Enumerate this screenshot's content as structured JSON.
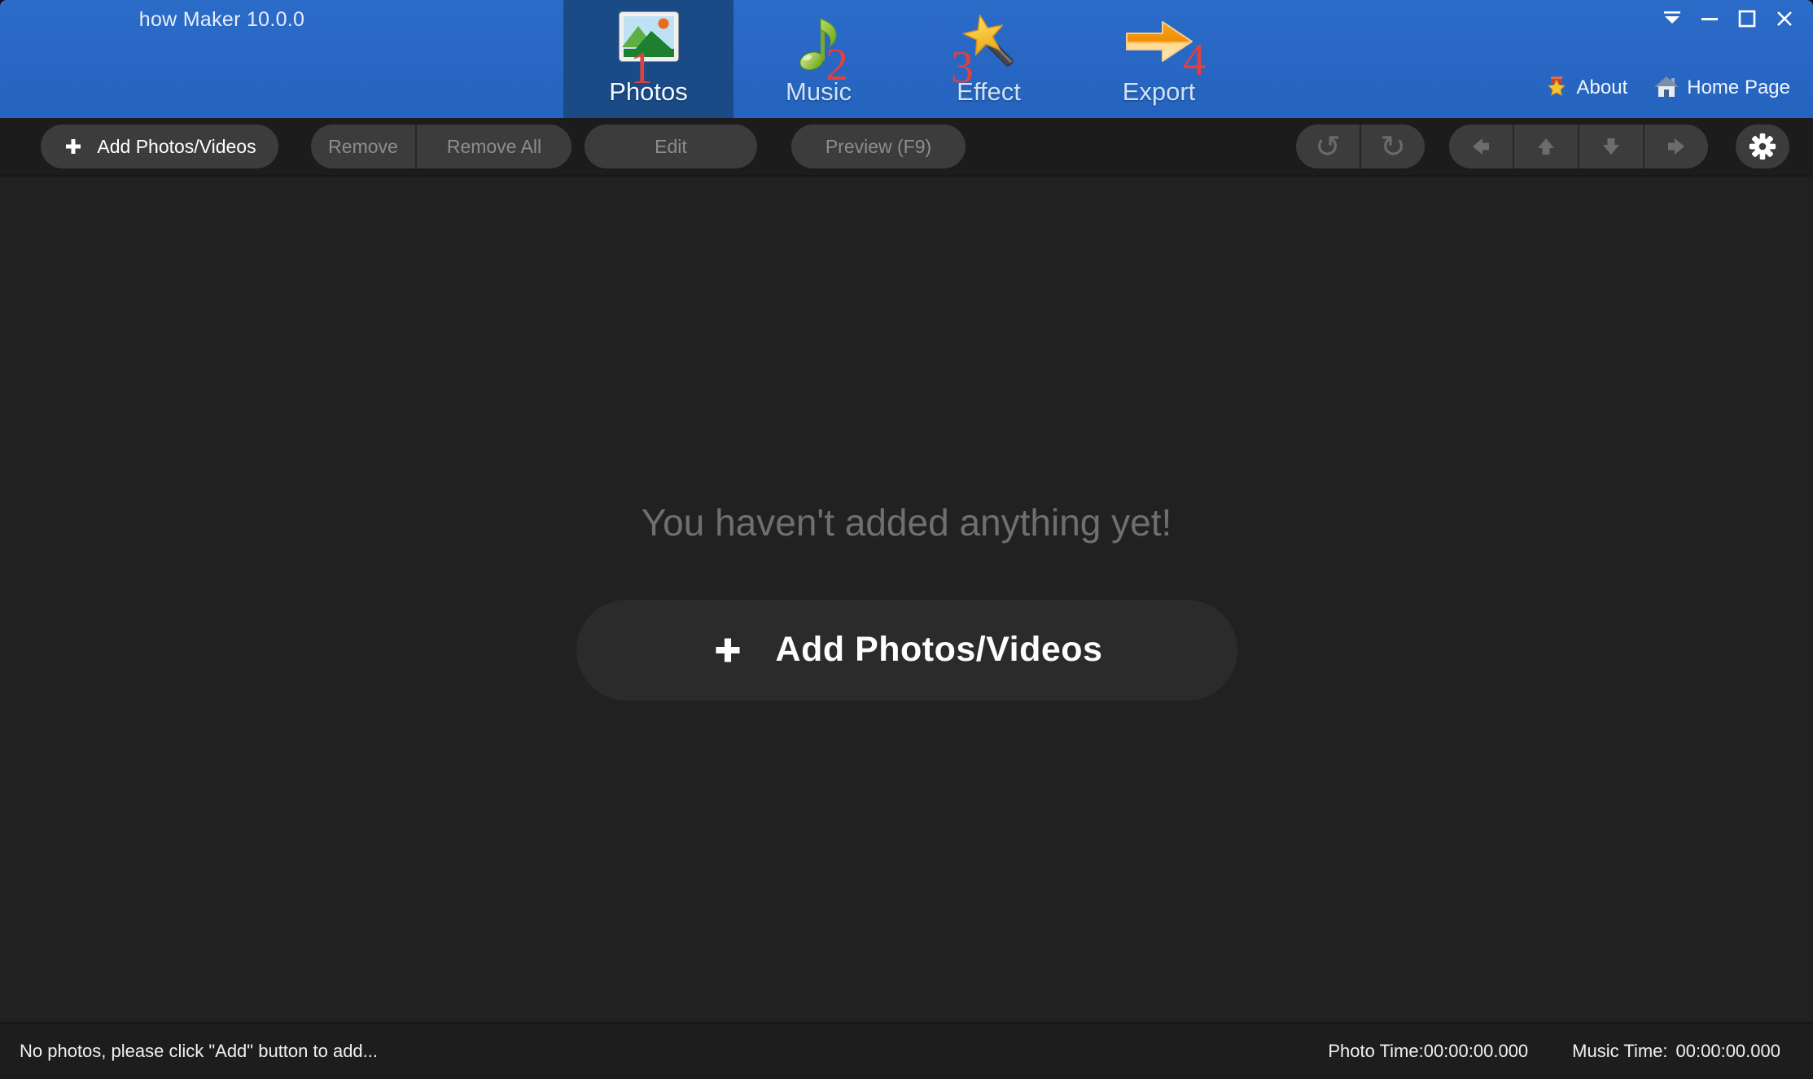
{
  "titlebar": {
    "title": "how Maker 10.0.0",
    "tabs": [
      {
        "label": "Photos",
        "number": "1",
        "icon": "photos-icon",
        "selected": true
      },
      {
        "label": "Music",
        "number": "2",
        "icon": "music-note-icon",
        "selected": false
      },
      {
        "label": "Effect",
        "number": "3",
        "icon": "magic-wand-icon",
        "selected": false
      },
      {
        "label": "Export",
        "number": "4",
        "icon": "export-arrow-icon",
        "selected": false
      }
    ],
    "links": [
      {
        "label": "About",
        "icon": "award-star-icon"
      },
      {
        "label": "Home Page",
        "icon": "home-icon"
      }
    ],
    "window_controls": [
      "collapse-icon",
      "minimize-icon",
      "maximize-icon",
      "close-icon"
    ]
  },
  "toolbar": {
    "add_button": "Add Photos/Videos",
    "remove_button": "Remove",
    "remove_all_button": "Remove All",
    "edit_button": "Edit",
    "preview_button": "Preview (F9)",
    "icon_buttons": [
      "undo-icon",
      "redo-icon",
      "move-left-icon",
      "move-up-icon",
      "move-down-icon",
      "move-right-icon",
      "settings-gear-icon"
    ]
  },
  "main": {
    "empty_message": "You haven't added anything yet!",
    "add_button_label": "Add Photos/Videos"
  },
  "statusbar": {
    "left_text": "No photos, please click \"Add\" button to add...",
    "photo_time_label": "Photo Time:",
    "photo_time_value": "00:00:00.000",
    "music_time_label": "Music Time:",
    "music_time_value": "00:00:00.000"
  },
  "colors": {
    "titlebar_blue": "#2a68c4",
    "selected_tab_blue": "#1a4b87",
    "step_number_red": "#e04040",
    "toolbar_button_gray": "#3c3c3c",
    "main_background": "#212121",
    "disabled_text": "#8d8d8d"
  }
}
